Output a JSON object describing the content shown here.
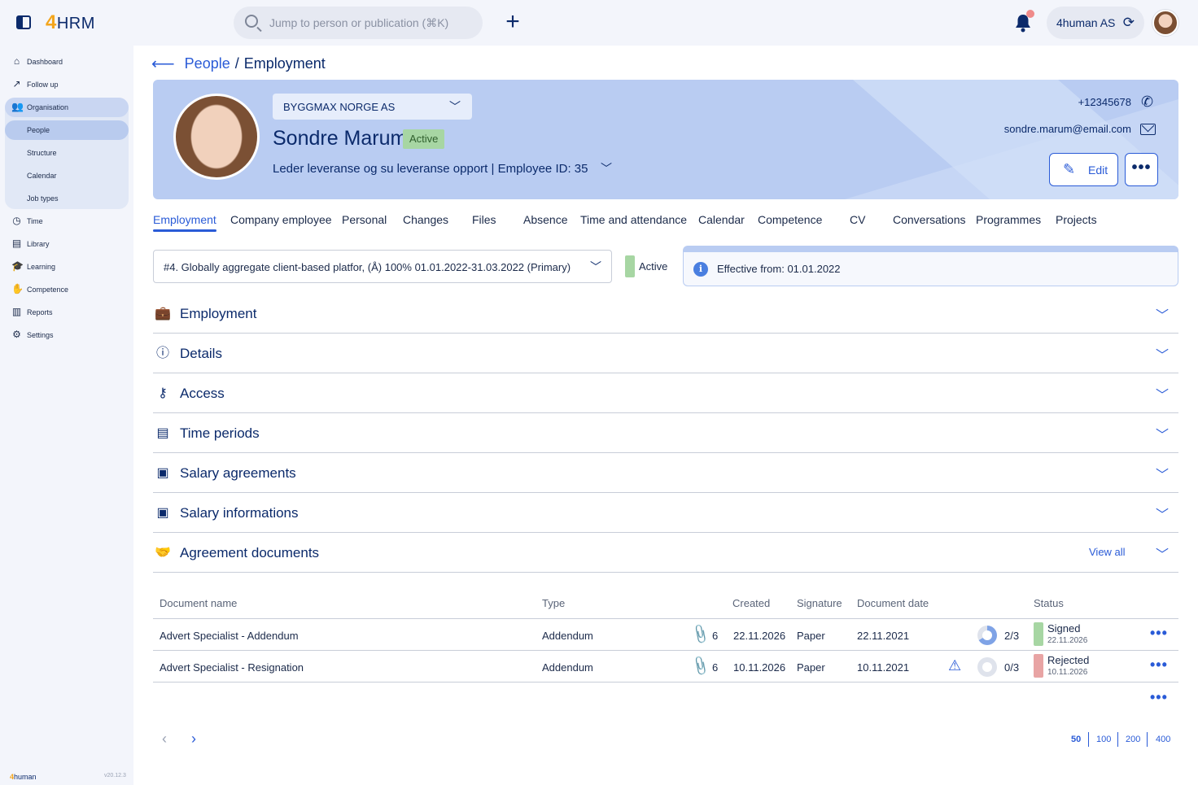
{
  "app": {
    "logo_prefix": "4",
    "logo_text": "HRM"
  },
  "topbar": {
    "search_placeholder": "Jump to person or publication (⌘K)",
    "company": "4human AS",
    "add_label": "+"
  },
  "sidebar": {
    "items": [
      {
        "label": "Dashboard",
        "icon": "home-icon"
      },
      {
        "label": "Follow up",
        "icon": "chart-line-icon"
      },
      {
        "label": "Organisation",
        "icon": "people-group-icon"
      },
      {
        "label": "People"
      },
      {
        "label": "Structure"
      },
      {
        "label": "Calendar"
      },
      {
        "label": "Job types"
      },
      {
        "label": "Time",
        "icon": "clock-icon"
      },
      {
        "label": "Library",
        "icon": "book-icon"
      },
      {
        "label": "Learning",
        "icon": "graduation-cap-icon"
      },
      {
        "label": "Competence",
        "icon": "competence-icon"
      },
      {
        "label": "Reports",
        "icon": "bar-chart-icon"
      },
      {
        "label": "Settings",
        "icon": "gear-icon"
      }
    ],
    "footer_logo_prefix": "4",
    "footer_logo_text": "human",
    "version": "v20.12.3"
  },
  "breadcrumb": {
    "parent": "People",
    "separator": "/",
    "current": "Employment"
  },
  "profile": {
    "company": "BYGGMAX NORGE AS",
    "name": "Sondre Marum",
    "status": "Active",
    "role": "Leder leveranse og su leveranse opport  | Employee ID: 35",
    "phone": "+12345678",
    "email": "sondre.marum@email.com",
    "edit_label": "Edit",
    "more_label": "•••"
  },
  "tabs": [
    "Employment",
    "Company employee",
    "Personal",
    "Changes",
    "Files",
    "Absence",
    "Time and attendance",
    "Calendar",
    "Competence",
    "CV",
    "Conversations",
    "Programmes",
    "Projects"
  ],
  "employment_select": {
    "value": "#4. Globally aggregate client-based platfor, (Å) 100% 01.01.2022-31.03.2022 (Primary)",
    "status": "Active",
    "effective": "Effective from: 01.01.2022"
  },
  "sections": [
    {
      "title": "Employment",
      "icon": "briefcase-icon"
    },
    {
      "title": "Details",
      "icon": "info-circle-icon"
    },
    {
      "title": "Access",
      "icon": "key-icon"
    },
    {
      "title": "Time periods",
      "icon": "calendar-clock-icon"
    },
    {
      "title": "Salary agreements",
      "icon": "money-icon"
    },
    {
      "title": "Salary informations",
      "icon": "money-icon"
    },
    {
      "title": "Agreement documents",
      "icon": "handshake-icon"
    }
  ],
  "view_all": "View all",
  "table": {
    "headers": {
      "name": "Document name",
      "type": "Type",
      "created": "Created",
      "signature": "Signature",
      "document_date": "Document date",
      "status": "Status"
    },
    "rows": [
      {
        "name": "Advert Specialist - Addendum",
        "type": "Addendum",
        "attachments": "6",
        "created": "22.11.2026",
        "signature": "Paper",
        "document_date": "22.11.2021",
        "progress": "2/3",
        "progress_fraction": 0.667,
        "status": "Signed",
        "status_date": "22.11.2026",
        "status_color": "#a7d6a3",
        "warning": false
      },
      {
        "name": "Advert Specialist - Resignation",
        "type": "Addendum",
        "attachments": "6",
        "created": "10.11.2026",
        "signature": "Paper",
        "document_date": "10.11.2021",
        "progress": "0/3",
        "progress_fraction": 0,
        "status": "Rejected",
        "status_date": "10.11.2026",
        "status_color": "#e8a4a4",
        "warning": true
      }
    ],
    "row_more": "•••"
  },
  "pagination": {
    "prev": "‹",
    "next": "›",
    "sizes": [
      "50",
      "100",
      "200",
      "400"
    ],
    "active_size": "50"
  },
  "colors": {
    "accent": "#2a5bd7",
    "navy": "#0b2a6b",
    "hero": "#b9ccf2",
    "active_green": "#a7d6a3"
  }
}
